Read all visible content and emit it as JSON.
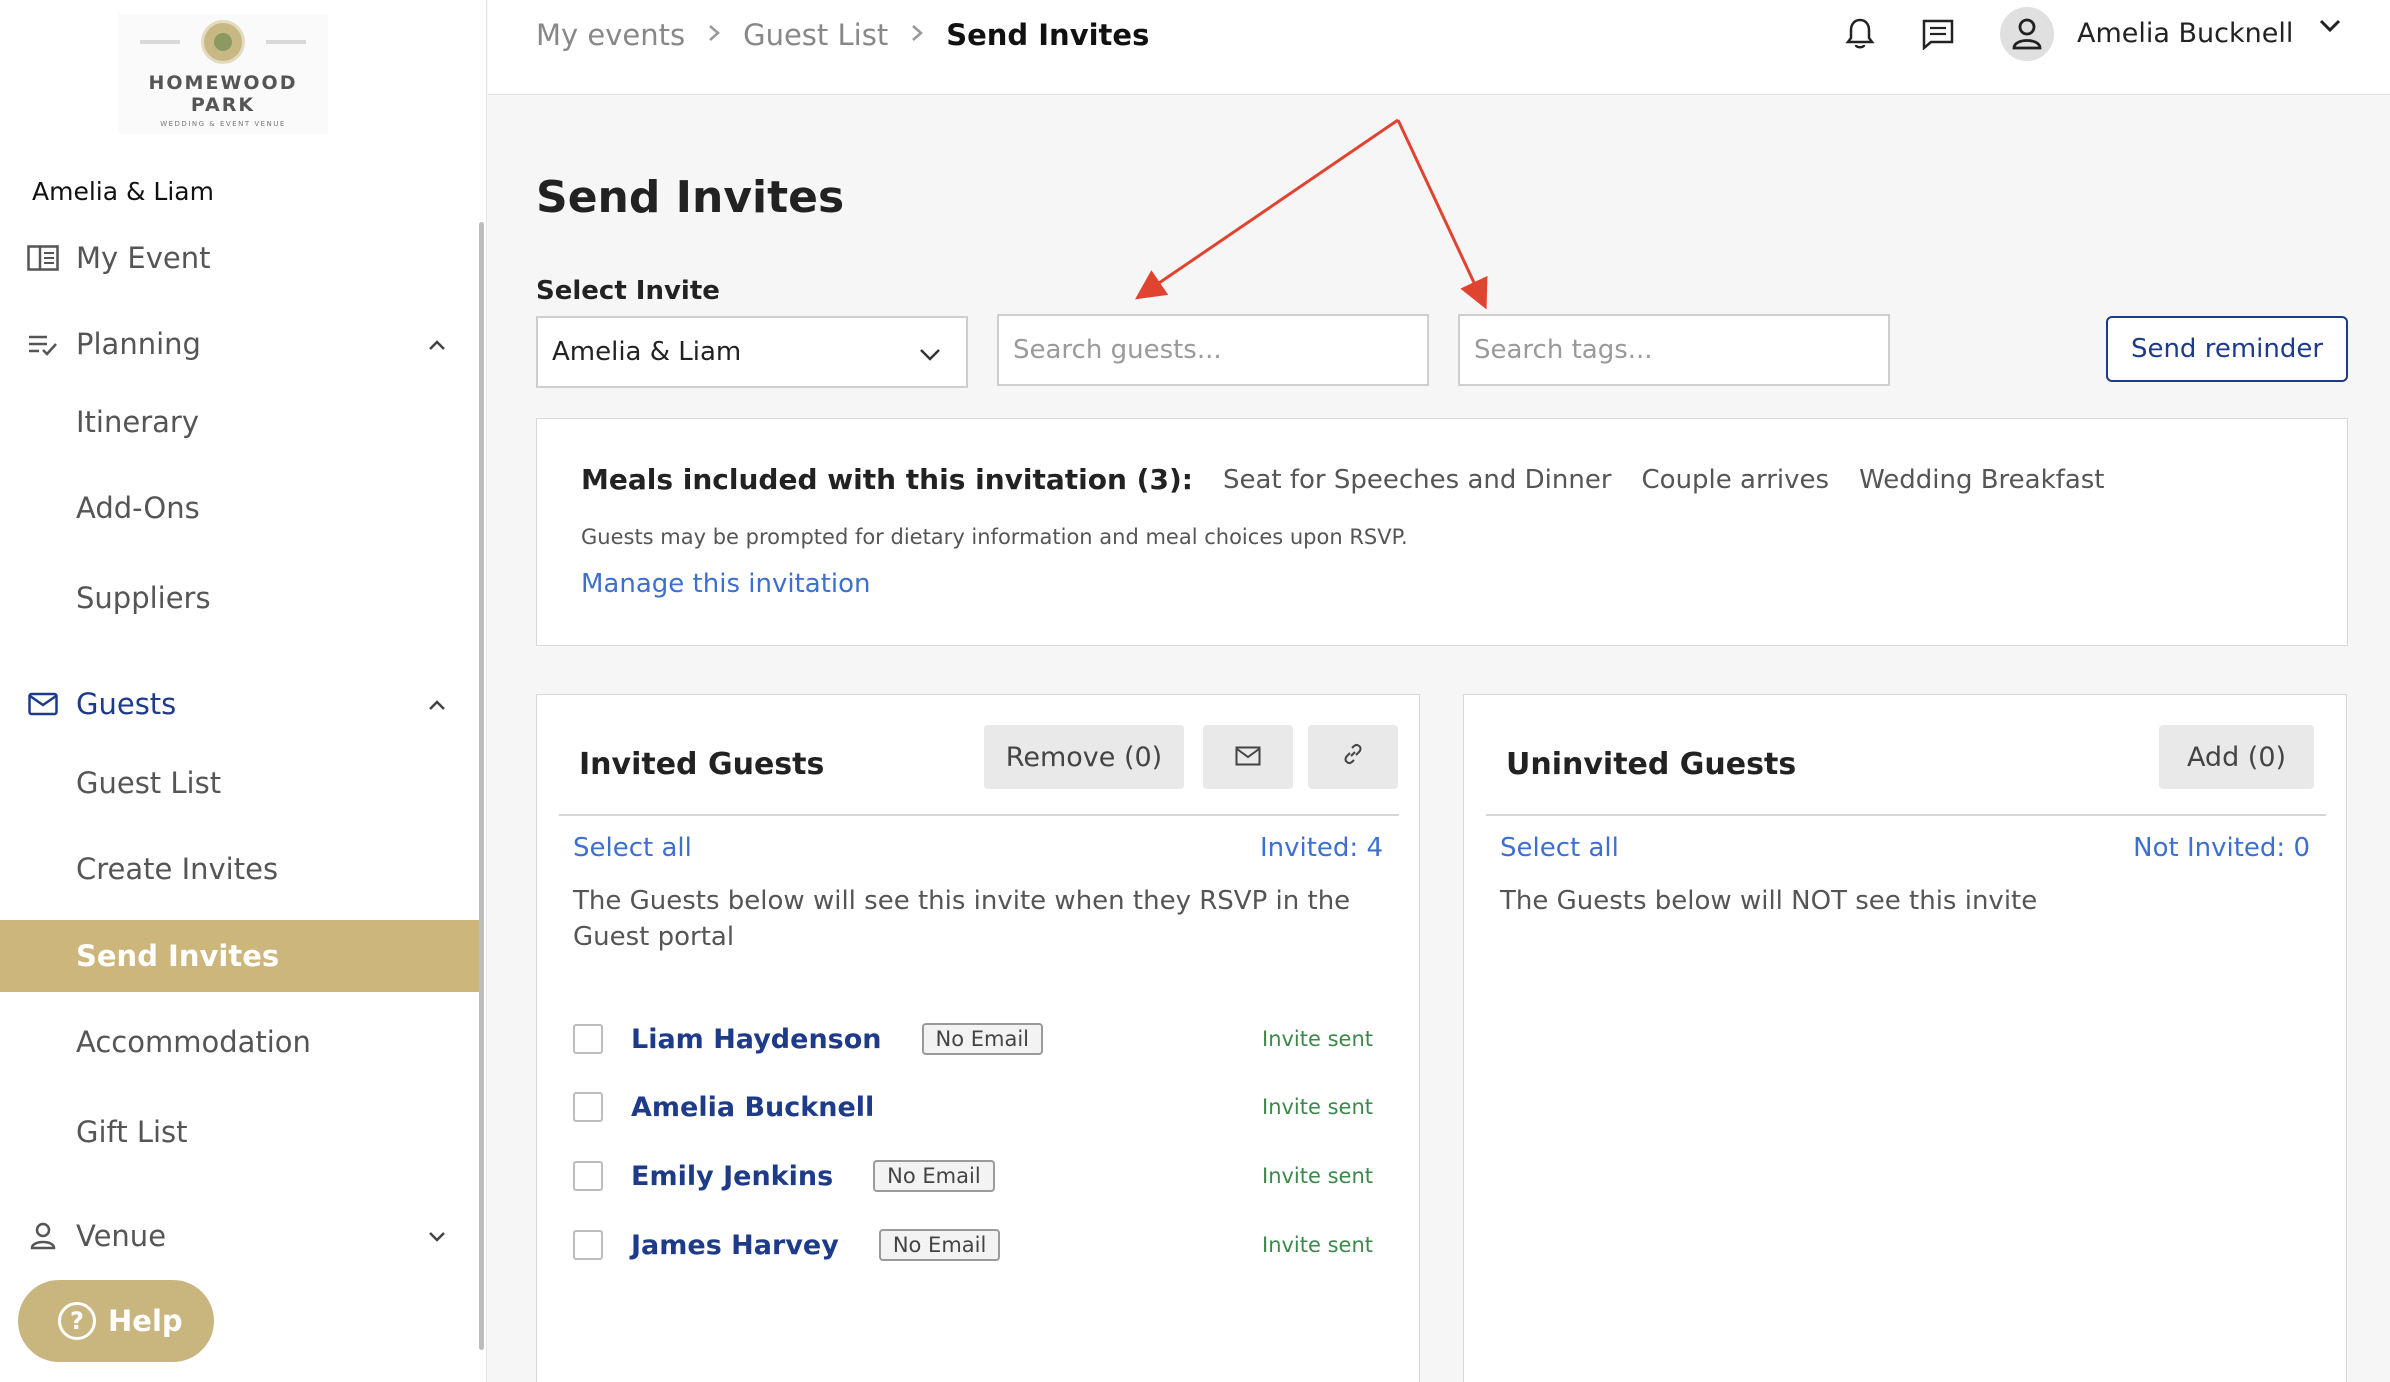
{
  "logo": {
    "line1": "HOMEWOOD",
    "line2": "PARK",
    "line3": "WEDDING & EVENT VENUE"
  },
  "sidebar": {
    "event_name": "Amelia & Liam",
    "items": [
      {
        "label": "My Event"
      },
      {
        "label": "Planning"
      },
      {
        "label": "Itinerary"
      },
      {
        "label": "Add-Ons"
      },
      {
        "label": "Suppliers"
      },
      {
        "label": "Guests"
      },
      {
        "label": "Guest List"
      },
      {
        "label": "Create Invites"
      },
      {
        "label": "Send Invites"
      },
      {
        "label": "Accommodation"
      },
      {
        "label": "Gift List"
      },
      {
        "label": "Venue"
      }
    ],
    "help_label": "Help"
  },
  "topbar": {
    "breadcrumbs": [
      "My events",
      "Guest List",
      "Send Invites"
    ],
    "user_name": "Amelia Bucknell"
  },
  "main": {
    "title": "Send Invites",
    "select_label": "Select Invite",
    "select_value": "Amelia & Liam",
    "search_guests_placeholder": "Search guests...",
    "search_tags_placeholder": "Search tags...",
    "send_reminder_label": "Send reminder",
    "meals": {
      "title": "Meals included with this invitation (3):",
      "items": [
        "Seat for Speeches and Dinner",
        "Couple arrives",
        "Wedding Breakfast"
      ],
      "note": "Guests may be prompted for dietary information and meal choices upon RSVP.",
      "manage_link": "Manage this invitation"
    },
    "invited": {
      "title": "Invited Guests",
      "remove_label": "Remove (0)",
      "select_all": "Select all",
      "count": "Invited: 4",
      "description": "The Guests below will see this invite when they RSVP in the Guest portal",
      "guests": [
        {
          "name": "Liam Haydenson",
          "badge": "No Email",
          "status": "Invite sent"
        },
        {
          "name": "Amelia Bucknell",
          "badge": "",
          "status": "Invite sent"
        },
        {
          "name": "Emily Jenkins",
          "badge": "No Email",
          "status": "Invite sent"
        },
        {
          "name": "James Harvey",
          "badge": "No Email",
          "status": "Invite sent"
        }
      ]
    },
    "uninvited": {
      "title": "Uninvited Guests",
      "add_label": "Add (0)",
      "select_all": "Select all",
      "count": "Not Invited: 0",
      "description": "The Guests below will NOT see this invite"
    }
  },
  "colors": {
    "accent_gold": "#cdb67b",
    "brand_navy": "#1e3b8a",
    "link_blue": "#3d6fd0",
    "status_green": "#3b8a4a",
    "annotation_red": "#e0432f"
  }
}
